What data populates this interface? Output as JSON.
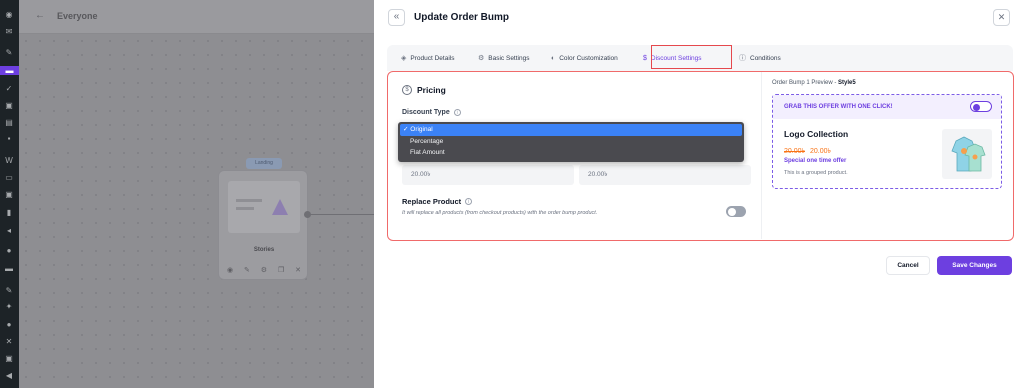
{
  "sidebar_icons": [
    "dashboard-icon",
    "mail-icon",
    "pin-icon",
    "cartflows-icon",
    "checklist-icon",
    "media-icon",
    "pages-icon",
    "comments-icon",
    "woo-icon",
    "products-icon",
    "payments-icon",
    "analytics-icon",
    "marketing-icon",
    "elementor-icon",
    "templates-icon",
    "appearance-icon",
    "plugins-icon",
    "users-icon",
    "tools-icon",
    "settings-icon",
    "collapse-icon"
  ],
  "canvas": {
    "page_title": "Everyone",
    "node": {
      "tag": "Landing",
      "name": "Stories"
    }
  },
  "modal": {
    "title": "Update Order Bump",
    "tabs": [
      {
        "label": "Product Details",
        "icon": "box-icon"
      },
      {
        "label": "Basic Settings",
        "icon": "gear-icon"
      },
      {
        "label": "Color Customization",
        "icon": "palette-icon"
      },
      {
        "label": "Discount Settings",
        "icon": "dollar-icon",
        "active": true
      },
      {
        "label": "Conditions",
        "icon": "info-icon"
      }
    ],
    "pricing": {
      "title": "Pricing",
      "discount_type_label": "Discount Type",
      "options": [
        "Original",
        "Percentage",
        "Flat Amount"
      ],
      "selected": "Original",
      "input_left": "20.00৳",
      "input_right": "20.00৳"
    },
    "replace": {
      "title": "Replace Product",
      "description": "It will replace all products (from checkout products) with the order bump product.",
      "enabled": false
    },
    "preview": {
      "label": "Order Bump 1 Preview - ",
      "style": "Style5",
      "cta": "GRAB THIS OFFER WITH ONE CLICK!",
      "product_name": "Logo Collection",
      "old_price": "20.00৳",
      "new_price": "20.00৳",
      "offer_text": "Special one time offer",
      "description": "This is a grouped product."
    },
    "buttons": {
      "cancel": "Cancel",
      "save": "Save Changes"
    }
  },
  "colors": {
    "accent": "#6d3fe0",
    "highlight": "#e5484d",
    "price": "#f97316"
  }
}
